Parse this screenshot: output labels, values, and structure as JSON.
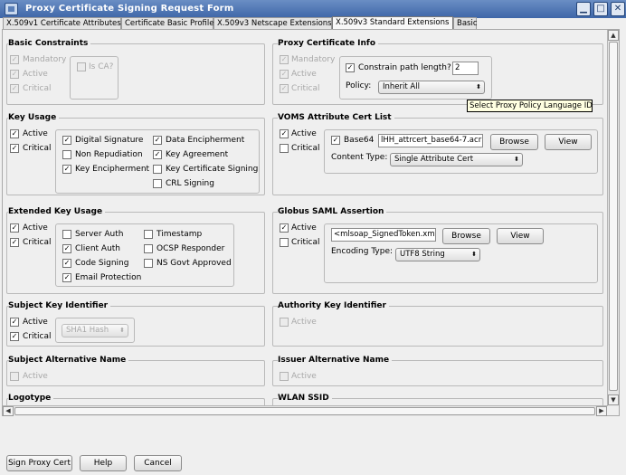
{
  "window": {
    "title": "Proxy Certificate Signing Request Form",
    "minimize_glyph": "▁",
    "maximize_glyph": "□",
    "close_glyph": "✕"
  },
  "tabs": [
    {
      "label": "X.509v1 Certificate Attributes"
    },
    {
      "label": "Certificate Basic Profile"
    },
    {
      "label": "X.509v3 Netscape Extensions"
    },
    {
      "label": "X.509v3 Standard Extensions"
    },
    {
      "label": "Basic"
    }
  ],
  "active_tab": 3,
  "basic_constraints": {
    "title": "Basic Constraints",
    "mandatory": "Mandatory",
    "active": "Active",
    "critical": "Critical",
    "is_ca": "Is CA?"
  },
  "proxy_cert_info": {
    "title": "Proxy Certificate Info",
    "mandatory": "Mandatory",
    "active": "Active",
    "critical": "Critical",
    "constrain_label": "Constrain path length?",
    "path_length": "2",
    "policy_label": "Policy:",
    "policy_value": "Inherit All"
  },
  "tooltip": {
    "text": "Select Proxy Policy Language ID"
  },
  "key_usage": {
    "title": "Key Usage",
    "active": "Active",
    "critical": "Critical",
    "items": [
      "Digital Signature",
      "Non Repudiation",
      "Key Encipherment",
      "Data Encipherment",
      "Key Agreement",
      "Key Certificate Signing",
      "CRL Signing"
    ]
  },
  "voms": {
    "title": "VOMS Attribute Cert List",
    "active": "Active",
    "critical": "Critical",
    "base64_label": "Base64",
    "file_value": "lHH_attrcert_base64-7.acr",
    "browse": "Browse",
    "view": "View",
    "content_type_label": "Content Type:",
    "content_type_value": "Single Attribute Cert"
  },
  "extended_key_usage": {
    "title": "Extended Key Usage",
    "active": "Active",
    "critical": "Critical",
    "items": [
      "Server Auth",
      "Client Auth",
      "Code Signing",
      "Email Protection",
      "Timestamp",
      "OCSP Responder",
      "NS Govt Approved"
    ]
  },
  "saml": {
    "title": "Globus SAML Assertion",
    "active": "Active",
    "critical": "Critical",
    "file_value": "<mlsoap_SignedToken.xml",
    "browse": "Browse",
    "view": "View",
    "encoding_label": "Encoding Type:",
    "encoding_value": "UTF8 String"
  },
  "ski": {
    "title": "Subject Key Identifier",
    "active": "Active",
    "critical": "Critical",
    "hash_value": "SHA1 Hash"
  },
  "aki": {
    "title": "Authority Key Identifier",
    "active": "Active"
  },
  "san": {
    "title": "Subject Alternative Name",
    "active": "Active"
  },
  "ian": {
    "title": "Issuer Alternative Name",
    "active": "Active"
  },
  "logotype": {
    "title": "Logotype"
  },
  "wlan": {
    "title": "WLAN SSID"
  },
  "buttons": {
    "sign": "Sign Proxy Cert",
    "help": "Help",
    "cancel": "Cancel"
  },
  "check": "✓",
  "arrows": {
    "up": "▲",
    "down": "▼",
    "left": "◀",
    "right": "▶",
    "updown": "⬍"
  }
}
